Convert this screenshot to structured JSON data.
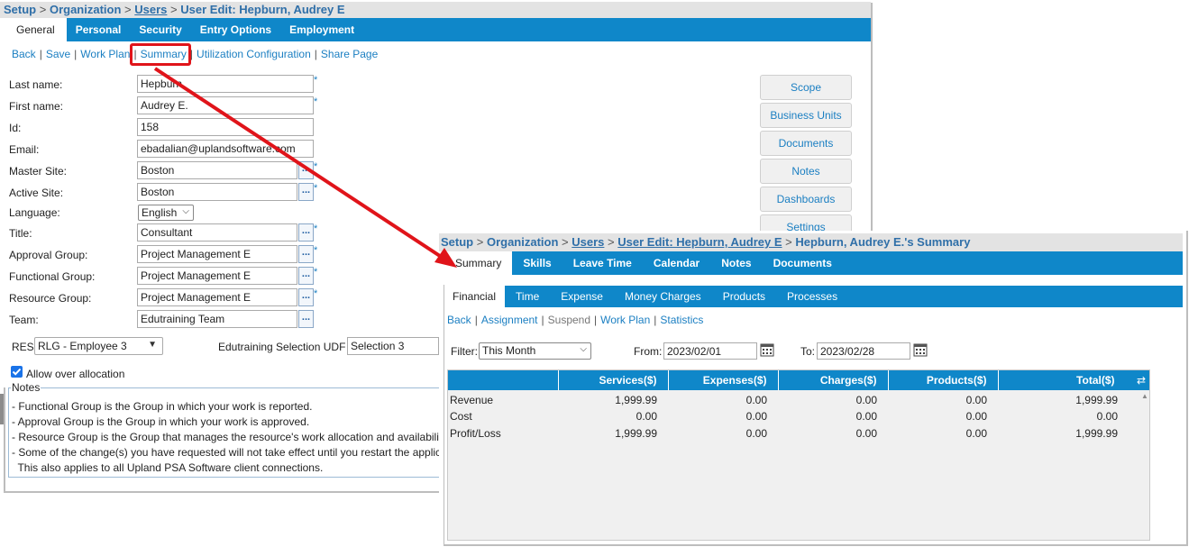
{
  "user_edit": {
    "breadcrumb": {
      "setup": "Setup",
      "sep": ">",
      "organization": "Organization",
      "users": "Users",
      "current": "User Edit: Hepburn, Audrey E"
    },
    "tabs": [
      "General",
      "Personal",
      "Security",
      "Entry Options",
      "Employment"
    ],
    "actions": {
      "back": "Back",
      "save": "Save",
      "work_plan": "Work Plan",
      "summary": "Summary",
      "utilization": "Utilization Configuration",
      "share": "Share Page",
      "sep": "|"
    },
    "fields": {
      "last_name": {
        "label": "Last name:",
        "value": "Hepburn"
      },
      "first_name": {
        "label": "First name:",
        "value": "Audrey E."
      },
      "id": {
        "label": "Id:",
        "value": "158"
      },
      "email": {
        "label": "Email:",
        "value": "ebadalian@uplandsoftware.com"
      },
      "master_site": {
        "label": "Master Site:",
        "value": "Boston"
      },
      "active_site": {
        "label": "Active Site:",
        "value": "Boston"
      },
      "language": {
        "label": "Language:",
        "value": "English"
      },
      "title": {
        "label": "Title:",
        "value": "Consultant"
      },
      "approval_group": {
        "label": "Approval Group:",
        "value": "Project Management E"
      },
      "functional_group": {
        "label": "Functional Group:",
        "value": "Project Management E"
      },
      "resource_group": {
        "label": "Resource Group:",
        "value": "Project Management E"
      },
      "team": {
        "label": "Team:",
        "value": "Edutraining Team"
      }
    },
    "required_mark": "*",
    "lookup_label": "...",
    "res": {
      "label": "RES",
      "value": "RLG - Employee 3"
    },
    "udf": {
      "label": "Edutraining Selection UDF",
      "value": "Selection 3"
    },
    "allow_over": {
      "label": "Allow over allocation",
      "checked": true
    },
    "side_buttons": [
      "Scope",
      "Business Units",
      "Documents",
      "Notes",
      "Dashboards",
      "Settings"
    ],
    "notes": {
      "legend": "Notes",
      "lines": [
        "- Functional Group is the Group in which your work is reported.",
        "- Approval Group is the Group in which your work is approved.",
        "- Resource Group is the Group that manages the resource's work allocation and availabili",
        "- Some of the change(s) you have requested will not take effect until you restart the applic",
        "  This also applies to all Upland PSA Software client connections."
      ]
    }
  },
  "summary": {
    "breadcrumb": {
      "setup": "Setup",
      "sep": ">",
      "organization": "Organization",
      "users": "Users",
      "user_edit": "User Edit: Hepburn, Audrey E",
      "current": "Hepburn, Audrey E.'s Summary"
    },
    "tabs": [
      "Summary",
      "Skills",
      "Leave Time",
      "Calendar",
      "Notes",
      "Documents"
    ],
    "subtabs": [
      "Financial",
      "Time",
      "Expense",
      "Money Charges",
      "Products",
      "Processes"
    ],
    "actions": {
      "back": "Back",
      "assignment": "Assignment",
      "suspend": "Suspend",
      "work_plan": "Work Plan",
      "statistics": "Statistics",
      "sep": "|"
    },
    "filter": {
      "label": "Filter:",
      "value": "This Month"
    },
    "from": {
      "label": "From:",
      "value": "2023/02/01"
    },
    "to": {
      "label": "To:",
      "value": "2023/02/28"
    },
    "table": {
      "columns": [
        "",
        "Services($)",
        "Expenses($)",
        "Charges($)",
        "Products($)",
        "Total($)"
      ],
      "rows": [
        [
          "Revenue",
          "1,999.99",
          "0.00",
          "0.00",
          "0.00",
          "1,999.99"
        ],
        [
          "Cost",
          "0.00",
          "0.00",
          "0.00",
          "0.00",
          "0.00"
        ],
        [
          "Profit/Loss",
          "1,999.99",
          "0.00",
          "0.00",
          "0.00",
          "1,999.99"
        ]
      ]
    }
  },
  "colors": {
    "tab_bar": "#0f87c9",
    "link": "#1b7fc2",
    "highlight": "#e0141a"
  }
}
